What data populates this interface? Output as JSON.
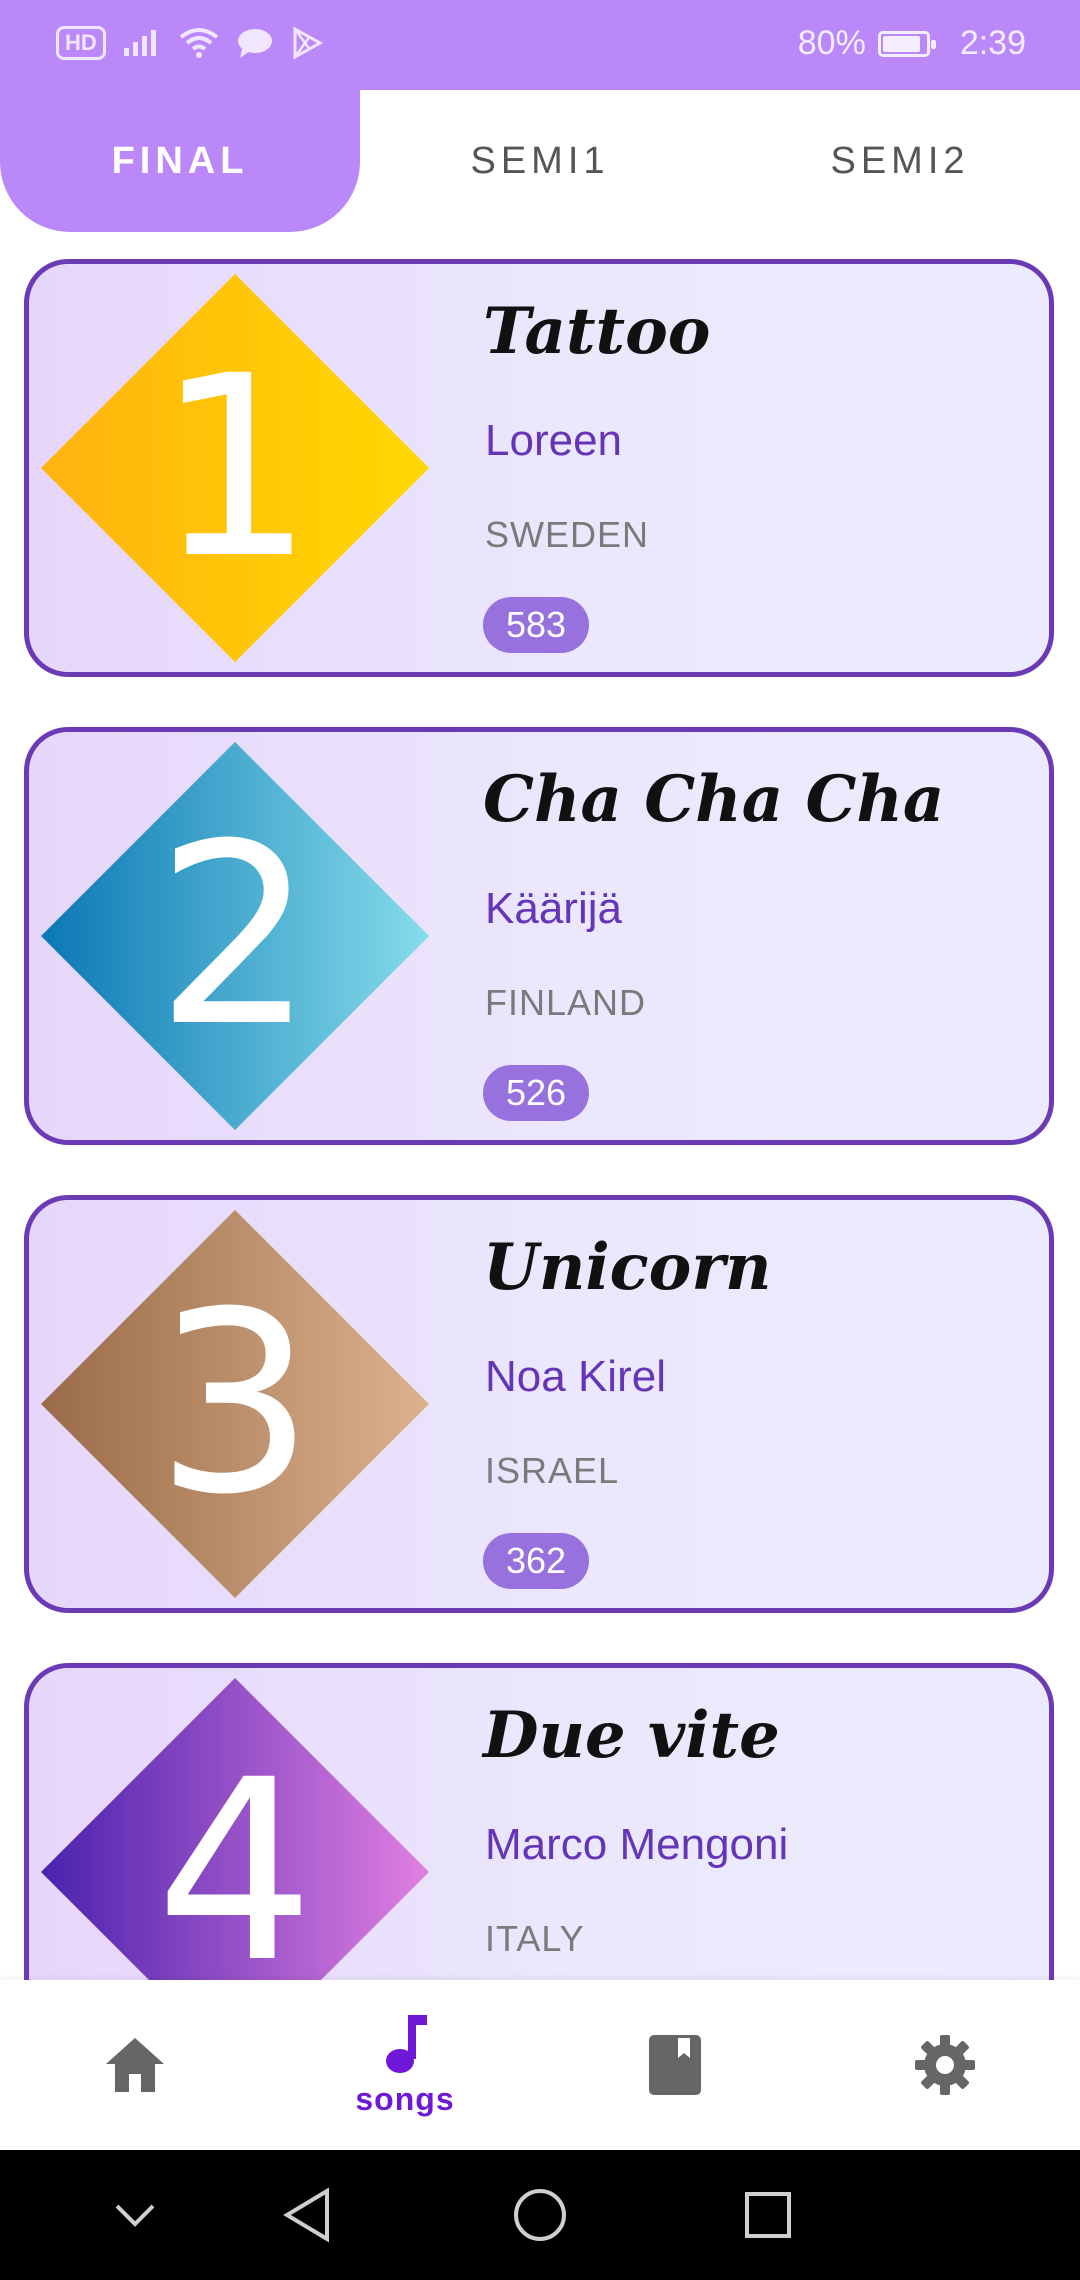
{
  "status_bar": {
    "hd_label": "HD",
    "battery_text": "80%",
    "time": "2:39"
  },
  "tabs": [
    {
      "label": "FINAL",
      "active": true
    },
    {
      "label": "SEMI1",
      "active": false
    },
    {
      "label": "SEMI2",
      "active": false
    }
  ],
  "songs": [
    {
      "rank": "1",
      "title": "Tattoo",
      "artist": "Loreen",
      "country": "SWEDEN",
      "points": "583",
      "badge_colors": [
        "#ffb30f",
        "#ffd800"
      ]
    },
    {
      "rank": "2",
      "title": "Cha Cha Cha",
      "artist": "Käärijä",
      "country": "FINLAND",
      "points": "526",
      "badge_colors": [
        "#0b78b4",
        "#85dcea"
      ]
    },
    {
      "rank": "3",
      "title": "Unicorn",
      "artist": "Noa Kirel",
      "country": "ISRAEL",
      "points": "362",
      "badge_colors": [
        "#9a6b48",
        "#dcb28e"
      ]
    },
    {
      "rank": "4",
      "title": "Due vite",
      "artist": "Marco Mengoni",
      "country": "ITALY",
      "points": "",
      "badge_colors": [
        "#4a22ad",
        "#e07fe0"
      ]
    }
  ],
  "bottom_nav": {
    "items": [
      {
        "icon": "home-icon",
        "label": ""
      },
      {
        "icon": "music-note-icon",
        "label": "songs",
        "active": true
      },
      {
        "icon": "book-icon",
        "label": ""
      },
      {
        "icon": "gear-icon",
        "label": ""
      }
    ]
  },
  "colors": {
    "accent": "#bb88fa",
    "card_border": "#6b3bb5",
    "artist_text": "#6435b6",
    "points_badge": "#9772de",
    "nav_active": "#6f18d8"
  }
}
